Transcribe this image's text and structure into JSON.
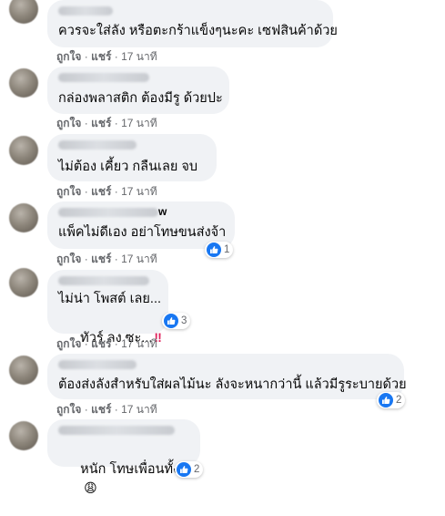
{
  "comments": [
    {
      "text": "ควรจะใส่ลัง หรือตะกร้าแข็งๆนะคะ เซฟสินค้าด้วย",
      "meta": {
        "like": "ถูกใจ",
        "reply": "แชร์",
        "time": "17 นาที"
      }
    },
    {
      "text": "กล่องพลาสติก ต้องมีรู ด้วยปะ",
      "meta": {
        "like": "ถูกใจ",
        "reply": "แชร์",
        "time": "17 นาที"
      }
    },
    {
      "text": "ไม่ต้อง เคี้ยว กลืนเลย จบ",
      "meta": {
        "like": "ถูกใจ",
        "reply": "แชร์",
        "time": "17 นาที"
      }
    },
    {
      "name_tail": "w",
      "text": "แพ็คไม่ดีเอง อย่าโทษขนส่งจ้า",
      "reactions": "1",
      "meta": {
        "like": "ถูกใจ",
        "reply": "แชร์",
        "time": "17 นาที"
      }
    },
    {
      "text_line1": "ไม่น่า โพสต์ เลย...",
      "text_line2": "ทัวร์ ลง ซะ...",
      "emoji": "‼",
      "reactions": "3",
      "meta": {
        "like": "ถูกใจ",
        "reply": "แชร์",
        "time": "17 นาที"
      }
    },
    {
      "text": "ต้องส่งลังสำหรับใส่ผลไม้นะ ลังจะหนากว่านี้ แล้วมีรูระบายด้วย",
      "reactions": "2",
      "meta": {
        "like": "ถูกใจ",
        "reply": "แชร์",
        "time": "17 นาที"
      }
    },
    {
      "text": "หนัก โทษเพื่อนทั้งเพ",
      "emoji": "😩",
      "reactions": "2"
    }
  ],
  "separator": " · ",
  "colors": {
    "bubble": "#f0f2f5",
    "meta": "#65676b",
    "like_blue": "#1877f2"
  }
}
